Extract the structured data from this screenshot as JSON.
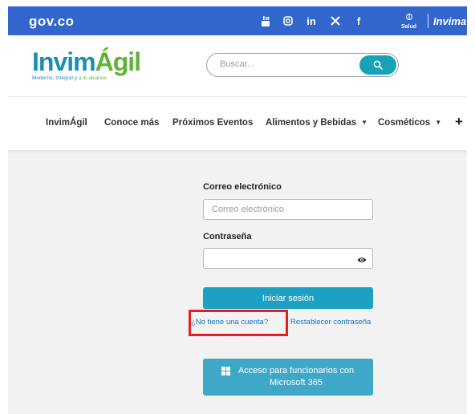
{
  "govbar": {
    "logo": "ɡov.co",
    "social_icons": [
      "youtube-icon",
      "instagram-icon",
      "linkedin-icon",
      "x-icon",
      "facebook-icon"
    ],
    "salud_label": "Salud",
    "invima_label": "Invima"
  },
  "header": {
    "brand": {
      "part1": "Invim",
      "part2": "Ágil",
      "tagline_blue": "Moderno, Integral y ",
      "tagline_green": "a tu alcance"
    },
    "search": {
      "placeholder": "Buscar..."
    }
  },
  "nav": {
    "items": [
      {
        "label": "InvimÁgil"
      },
      {
        "label": "Conoce más"
      },
      {
        "label": "Próximos Eventos"
      },
      {
        "label": "Alimentos y Bebidas",
        "dropdown": true
      },
      {
        "label": "Cosméticos",
        "dropdown": true
      }
    ],
    "more": "+"
  },
  "login": {
    "email_label": "Correo electrónico",
    "email_placeholder": "Correo electrónico",
    "password_label": "Contraseña",
    "submit_label": "Iniciar sesión",
    "no_account_link": "¿No tiene una cuenta?",
    "reset_link": "Restablecer contraseña",
    "ms_button_label": "Acceso para funcionarios con Microsoft 365"
  },
  "colors": {
    "gov_blue": "#3366cc",
    "brand_blue": "#1d8eb1",
    "brand_green": "#5fb339",
    "button_teal": "#1da1c3",
    "highlight_red": "#ea1b22"
  }
}
